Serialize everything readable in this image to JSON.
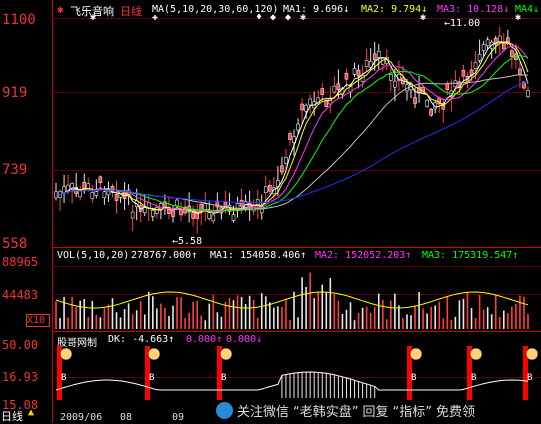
{
  "header": {
    "stock_name": "飞乐音响",
    "period": "日线",
    "ma_label": "MA(5,10,20,30,60,120)",
    "ma1": "MA1: 9.696↓",
    "ma2": "MA2: 9.794↓",
    "ma3": "MA3: 10.128↓",
    "ma4": "MA4↓"
  },
  "price_axis": {
    "top": "1100",
    "mid1": "919",
    "mid2": "739",
    "low": "558"
  },
  "annotations": {
    "high": "←11.00",
    "low": "←5.58"
  },
  "volume": {
    "label": "VOL(5,10,20)",
    "value": "278767.000↑",
    "ma1": "MA1: 154058.406↑",
    "ma2": "MA2: 152052.203↑",
    "ma3": "MA3: 175319.547↑",
    "axis_top": "88965",
    "axis_mid": "44483",
    "axis_unit": "X10"
  },
  "indicator": {
    "name": "股哥网制",
    "dk": "DK: -4.663↑",
    "v1": "0.000↑",
    "v2": "0.000↓",
    "axis_top": "50.00",
    "axis_mid": "16.93",
    "axis_low": "15.08",
    "signal_label": "B"
  },
  "footer": {
    "period_tab": "日线",
    "date1": "2009/06",
    "date2": "08",
    "date3": "09"
  },
  "watermark": {
    "prefix": "关注微信",
    "q1": "“老韩实盘”",
    "mid": "回复",
    "q2": "“指标”",
    "suffix": "免费领"
  },
  "colors": {
    "ma1": "#ffffff",
    "ma2": "#ffff00",
    "ma3": "#ff33ff",
    "ma4": "#00ff00",
    "ma5": "#c0c0c0",
    "ma6": "#2030ff",
    "grid": "#cc0000",
    "axis_text": "#ff3333"
  }
}
